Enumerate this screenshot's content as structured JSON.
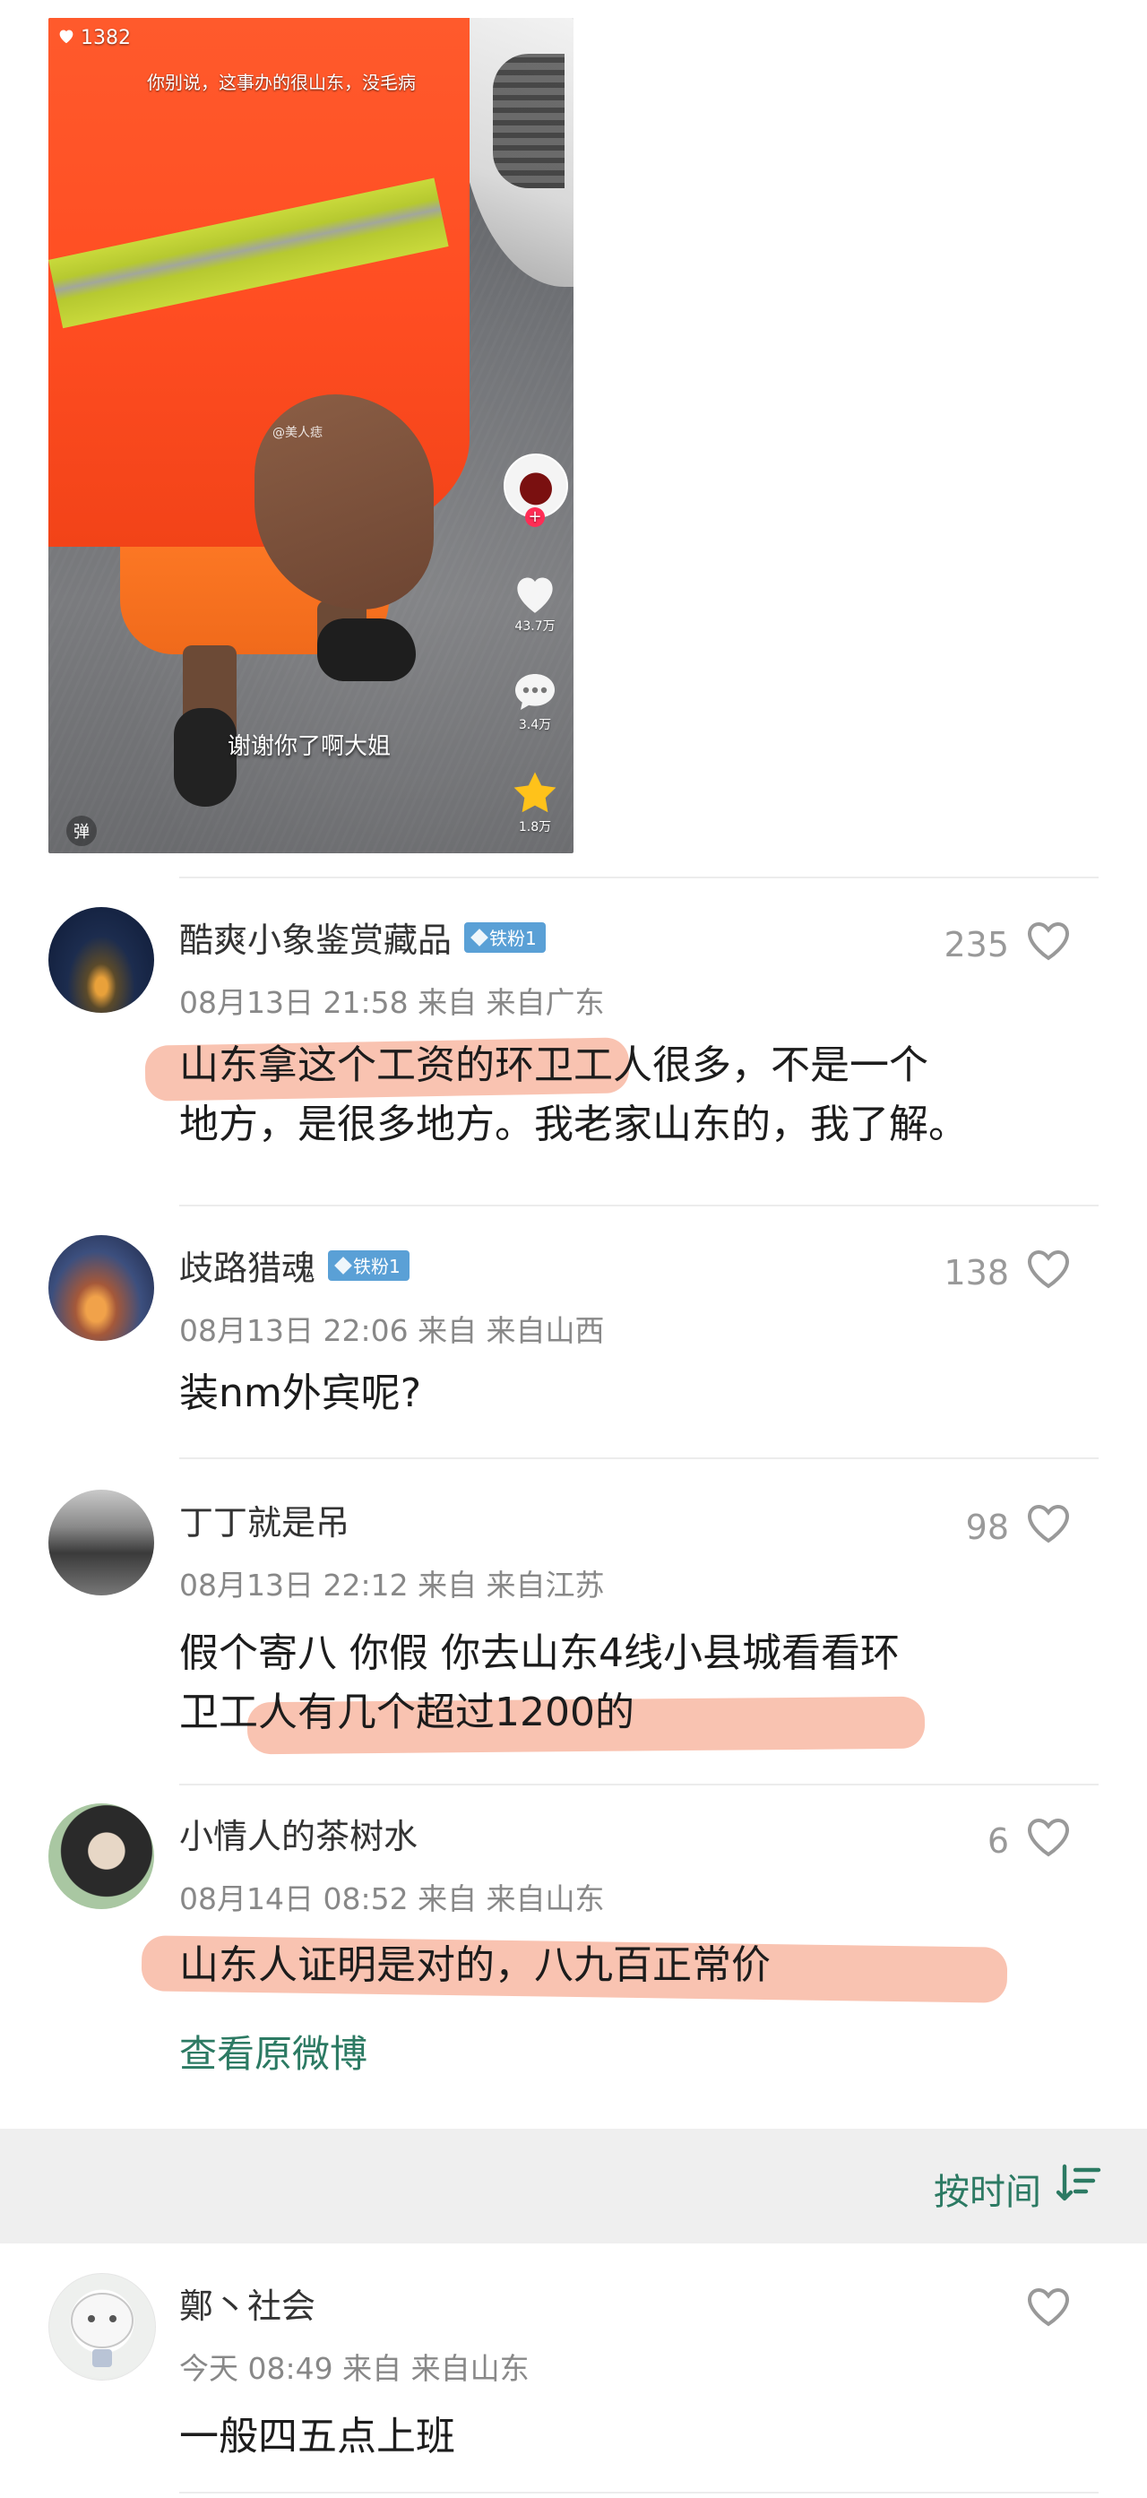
{
  "video": {
    "like_count": "1382",
    "caption": "你别说，这事办的很山东，没毛病",
    "watermark": "@美人痣",
    "subtitle": "谢谢你了啊大姐",
    "danmu_label": "弹",
    "side_likes": "43.7万",
    "side_comments": "3.4万",
    "side_favorites": "1.8万",
    "accent_color": "#ff5a2c"
  },
  "comments": [
    {
      "username": "酷爽小象鉴赏藏品",
      "badge": "铁粉1",
      "time": "08月13日 21:58 来自 来自广东",
      "likes": "235",
      "lines": [
        "山东拿这个工资的环卫工人很多，不是一个",
        "地方，是很多地方。我老家山东的，我了解。"
      ],
      "avatar": "night-city"
    },
    {
      "username": "歧路猎魂",
      "badge": "铁粉1",
      "time": "08月13日 22:06 来自 来自山西",
      "likes": "138",
      "lines": [
        "装nm外宾呢?"
      ],
      "avatar": "mountain-sunset"
    },
    {
      "username": "丁丁就是吊",
      "badge": "",
      "time": "08月13日 22:12 来自 来自江苏",
      "likes": "98",
      "lines": [
        "假个寄八 你假 你去山东4线小县城看看环",
        "卫工人有几个超过1200的"
      ],
      "avatar": "street-bw"
    },
    {
      "username": "小情人的茶树水",
      "badge": "",
      "time": "08月14日 08:52 来自 来自山东",
      "likes": "6",
      "lines": [
        "山东人证明是对的，八九百正常价"
      ],
      "avatar": "anime-girl"
    }
  ],
  "view_original": "查看原微博",
  "sort": {
    "label": "按时间",
    "icon": "sort-descending-icon"
  },
  "reply": {
    "username": "鄭丶社会",
    "time": "今天 08:49 来自 来自山东",
    "likes": "",
    "text": "一般四五点上班",
    "avatar": "cartoon-face"
  },
  "colors": {
    "link_green": "#2c7a63",
    "highlight": "#f8b8a3",
    "badge_blue": "#5aa0d6"
  }
}
